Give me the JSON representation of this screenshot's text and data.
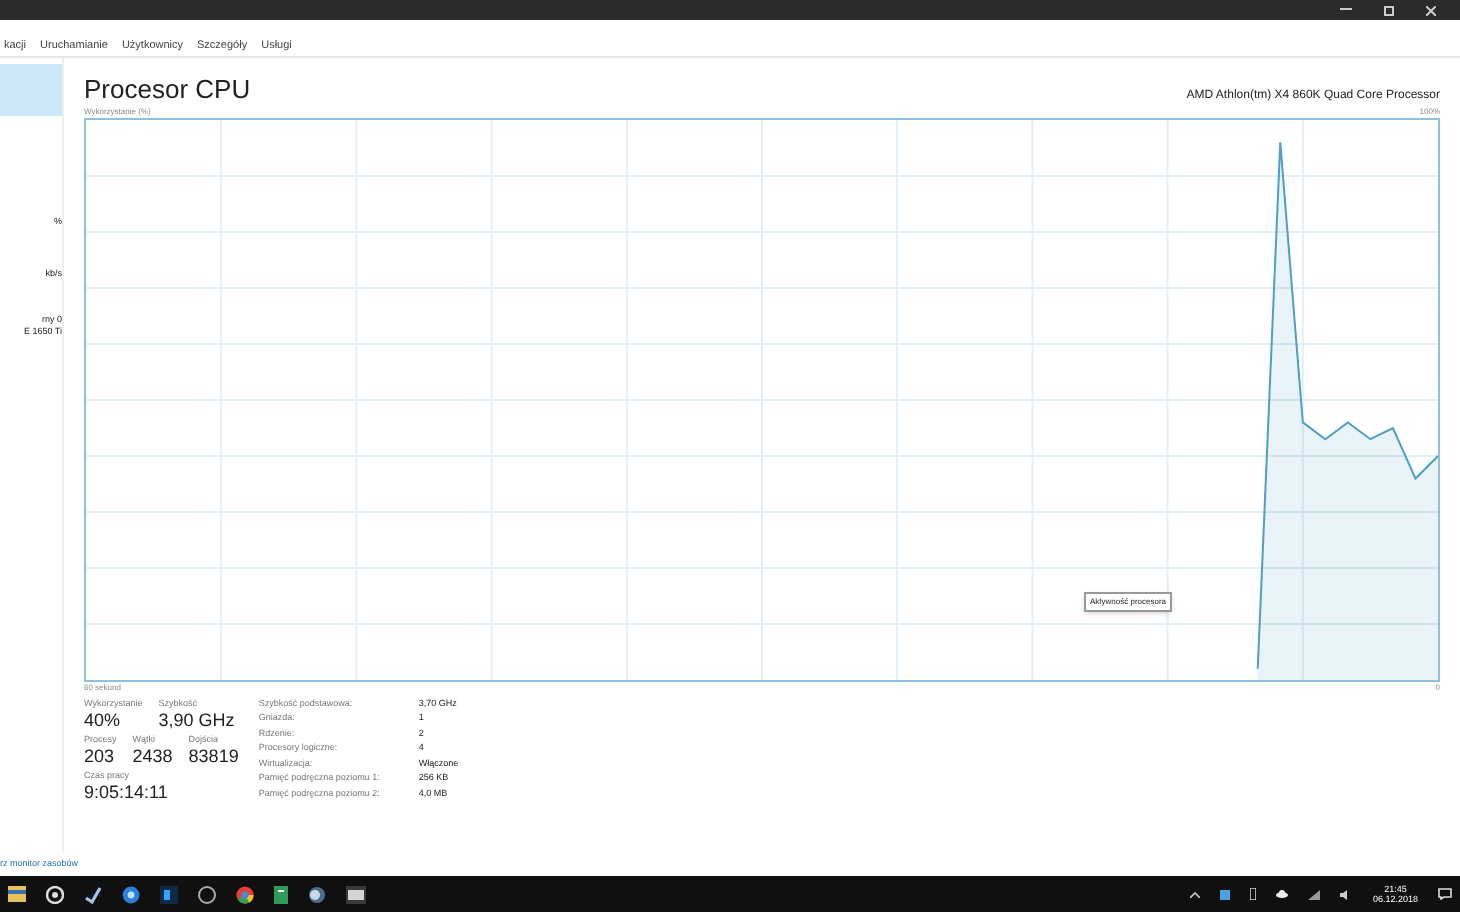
{
  "tabs": [
    {
      "label": "kacji",
      "selected": false
    },
    {
      "label": "Uruchamianie",
      "selected": false
    },
    {
      "label": "Użytkownicy",
      "selected": false
    },
    {
      "label": "Szczegóły",
      "selected": false
    },
    {
      "label": "Usługi",
      "selected": false
    }
  ],
  "sidebar": {
    "items": [
      {
        "selected": true
      },
      {
        "lines": [
          "%"
        ],
        "selected": false
      },
      {
        "lines": [
          "kb/s"
        ],
        "selected": false
      },
      {
        "lines": [
          "rny 0",
          "E 1650 Ti"
        ],
        "selected": false
      }
    ]
  },
  "panel": {
    "title": "Procesor CPU",
    "processor": "AMD Athlon(tm) X4 860K Quad Core Processor",
    "graph": {
      "axis_label": "Wykorzystanie (%)",
      "max_label": "100%",
      "time_start": "60 sekund",
      "time_end": "0"
    },
    "tooltip": "Aktywność procesora",
    "big_stats": [
      [
        {
          "label": "Wykorzystanie",
          "value": "40%"
        },
        {
          "label": "Szybkość",
          "value": "3,90 GHz"
        }
      ],
      [
        {
          "label": "Procesy",
          "value": "203"
        },
        {
          "label": "Wątki",
          "value": "2438"
        },
        {
          "label": "Dojścia",
          "value": "83819"
        }
      ],
      [
        {
          "label": "Czas pracy",
          "value": "9:05:14:11"
        }
      ]
    ],
    "details": [
      {
        "label": "Szybkość podstawowa:",
        "value": "3,70 GHz"
      },
      {
        "label": "Gniazda:",
        "value": "1"
      },
      {
        "label": "Rdzenie:",
        "value": "2"
      },
      {
        "label": "Procesory logiczne:",
        "value": "4"
      },
      {
        "label": "Wirtualizacja:",
        "value": "Włączone"
      },
      {
        "label": "Pamięć podręczna poziomu 1:",
        "value": "256 KB"
      },
      {
        "label": "Pamięć podręczna poziomu 2:",
        "value": "4,0 MB"
      }
    ]
  },
  "footer_link": "rz monitor zasobów",
  "taskbar": {
    "time": "21:45",
    "date": "06.12.2018"
  }
}
